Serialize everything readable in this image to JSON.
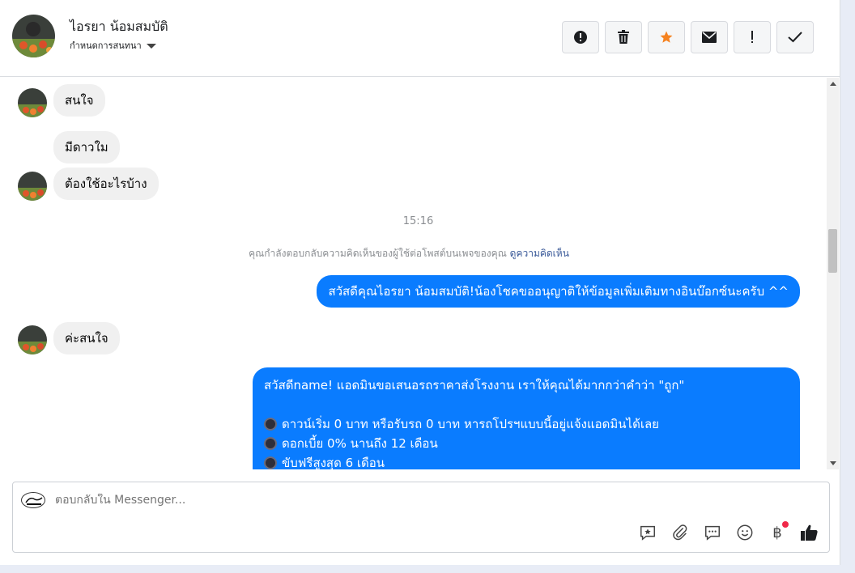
{
  "header": {
    "name": "ไอรยา น้อมสมบัติ",
    "assign_label": "กำหนดการสนทนา",
    "toolbar": [
      {
        "icon": "alert-circle-icon"
      },
      {
        "icon": "trash-icon"
      },
      {
        "icon": "star-icon"
      },
      {
        "icon": "envelope-icon"
      },
      {
        "icon": "exclamation-icon"
      },
      {
        "icon": "check-icon"
      }
    ]
  },
  "messages": {
    "incoming": [
      {
        "text": "สนใจ"
      },
      {
        "text": "มีดาวใม"
      },
      {
        "text": "ต้องใช้อะไรบ้าง"
      },
      {
        "text": "ค่ะสนใจ"
      }
    ],
    "timestamp": "15:16",
    "notice": {
      "text": "คุณกำลังตอบกลับความคิดเห็นของผู้ใช้ต่อโพสต์บนเพจของคุณ",
      "link": "ดูความคิดเห็น"
    },
    "outgoing_1": "สวัสดีคุณไอรยา น้อมสมบัติ!น้องโชคขออนุญาติให้ข้อมูลเพิ่มเติมทางอินบ๊อกซ์นะครับ ^^",
    "outgoing_2": {
      "line1": "สวัสดีname! แอดมินขอเสนอรถราคาส่งโรงงาน เราให้คุณได้มากกว่าคำว่า \"ถูก\"",
      "bullets": [
        "ดาวน์เริ่ม 0 บาท หรือรับรถ 0 บาท หารถโปรฯแบบนี้อยู่แจ้งแอดมินได้เลย",
        "ดอกเบี้ย 0% นานถึง 12 เดือน",
        "ขับฟรีสูงสุด 6 เดือน"
      ]
    }
  },
  "composer": {
    "placeholder": "ตอบกลับใน Messenger...",
    "baht_symbol": "฿"
  },
  "colors": {
    "outgoing_bubble": "#0a7cff",
    "incoming_bubble": "#f0f0f0",
    "star": "#f5821f",
    "notification_dot": "#f02849"
  }
}
